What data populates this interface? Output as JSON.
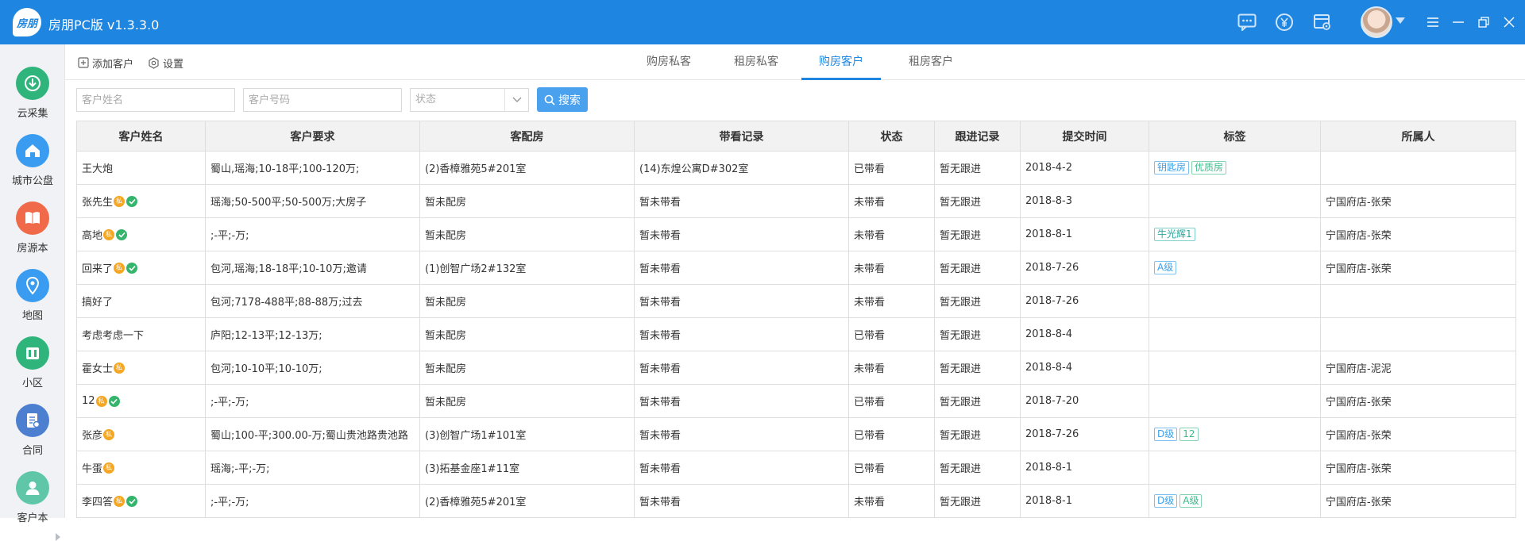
{
  "app": {
    "title": "房朋PC版 v1.3.3.0",
    "logo_text": "房朋"
  },
  "titlebar_icons": [
    "chat-icon",
    "yen-icon",
    "settings-card-icon"
  ],
  "sidebar": {
    "items": [
      {
        "label": "云采集",
        "icon": "download-cloud-icon",
        "color": "#2fb57b"
      },
      {
        "label": "城市公盘",
        "icon": "home-icon",
        "color": "#3a9cf0"
      },
      {
        "label": "房源本",
        "icon": "book-icon",
        "color": "#f06a4a"
      },
      {
        "label": "地图",
        "icon": "map-pin-icon",
        "color": "#3a9cf0"
      },
      {
        "label": "小区",
        "icon": "building-icon",
        "color": "#2fb57b"
      },
      {
        "label": "合同",
        "icon": "contract-icon",
        "color": "#4d7fd1"
      },
      {
        "label": "客户本",
        "icon": "customer-icon",
        "color": "#5fc7a8"
      }
    ]
  },
  "toolbar": {
    "add_customer": "添加客户",
    "settings": "设置",
    "tabs": [
      "购房私客",
      "租房私客",
      "购房客户",
      "租房客户"
    ],
    "active_tab": 2
  },
  "search": {
    "name_placeholder": "客户姓名",
    "phone_placeholder": "客户号码",
    "status_label": "状态",
    "button": "搜索"
  },
  "table": {
    "columns": [
      "客户姓名",
      "客户要求",
      "客配房",
      "带看记录",
      "状态",
      "跟进记录",
      "提交时间",
      "标签",
      "所属人"
    ],
    "rows": [
      {
        "name": "王大炮",
        "si": false,
        "ok": false,
        "req": "蜀山,瑶海;10-18平;100-120万;",
        "match": "(2)香樟雅苑5#201室",
        "visit": "(14)东煌公寓D#302室",
        "status": "已带看",
        "follow": "暂无跟进",
        "time": "2018-4-2",
        "tags": [
          {
            "t": "钥匙房",
            "c": "blue"
          },
          {
            "t": "优质房",
            "c": "green"
          }
        ],
        "owner": ""
      },
      {
        "name": "张先生",
        "si": true,
        "ok": true,
        "req": "瑶海;50-500平;50-500万;大房子",
        "match": "暂未配房",
        "visit": "暂未带看",
        "status": "未带看",
        "follow": "暂无跟进",
        "time": "2018-8-3",
        "tags": [],
        "owner": "宁国府店-张荣"
      },
      {
        "name": "高地",
        "si": true,
        "ok": true,
        "req": ";-平;-万;",
        "match": "暂未配房",
        "visit": "暂未带看",
        "status": "未带看",
        "follow": "暂无跟进",
        "time": "2018-8-1",
        "tags": [
          {
            "t": "牛光辉1",
            "c": "teal"
          }
        ],
        "owner": "宁国府店-张荣"
      },
      {
        "name": "回来了",
        "si": true,
        "ok": true,
        "req": "包河,瑶海;18-18平;10-10万;邀请",
        "match": "(1)创智广场2#132室",
        "visit": "暂未带看",
        "status": "未带看",
        "follow": "暂无跟进",
        "time": "2018-7-26",
        "tags": [
          {
            "t": "A级",
            "c": "blue"
          }
        ],
        "owner": "宁国府店-张荣"
      },
      {
        "name": "搞好了",
        "si": false,
        "ok": false,
        "req": "包河;7178-488平;88-88万;过去",
        "match": "暂未配房",
        "visit": "暂未带看",
        "status": "未带看",
        "follow": "暂无跟进",
        "time": "2018-7-26",
        "tags": [],
        "owner": ""
      },
      {
        "name": "考虑考虑一下",
        "si": false,
        "ok": false,
        "req": "庐阳;12-13平;12-13万;",
        "match": "暂未配房",
        "visit": "暂未带看",
        "status": "已带看",
        "follow": "暂无跟进",
        "time": "2018-8-4",
        "tags": [],
        "owner": ""
      },
      {
        "name": "霍女士",
        "si": true,
        "ok": false,
        "req": "包河;10-10平;10-10万;",
        "match": "暂未配房",
        "visit": "暂未带看",
        "status": "未带看",
        "follow": "暂无跟进",
        "time": "2018-8-4",
        "tags": [],
        "owner": "宁国府店-泥泥"
      },
      {
        "name": "12",
        "si": true,
        "ok": true,
        "req": ";-平;-万;",
        "match": "暂未配房",
        "visit": "暂未带看",
        "status": "已带看",
        "follow": "暂无跟进",
        "time": "2018-7-20",
        "tags": [],
        "owner": "宁国府店-张荣"
      },
      {
        "name": "张彦",
        "si": true,
        "ok": false,
        "req": "蜀山;100-平;300.00-万;蜀山贵池路贵池路",
        "match": "(3)创智广场1#101室",
        "visit": "暂未带看",
        "status": "已带看",
        "follow": "暂无跟进",
        "time": "2018-7-26",
        "tags": [
          {
            "t": "D级",
            "c": "blue"
          },
          {
            "t": "12",
            "c": "green"
          }
        ],
        "owner": "宁国府店-张荣"
      },
      {
        "name": "牛蛋",
        "si": true,
        "ok": false,
        "req": "瑶海;-平;-万;",
        "match": "(3)拓基金座1#11室",
        "visit": "暂未带看",
        "status": "已带看",
        "follow": "暂无跟进",
        "time": "2018-8-1",
        "tags": [],
        "owner": "宁国府店-张荣"
      },
      {
        "name": "李四答",
        "si": true,
        "ok": true,
        "req": ";-平;-万;",
        "match": "(2)香樟雅苑5#201室",
        "visit": "暂未带看",
        "status": "未带看",
        "follow": "暂无跟进",
        "time": "2018-8-1",
        "tags": [
          {
            "t": "D级",
            "c": "blue"
          },
          {
            "t": "A级",
            "c": "green"
          }
        ],
        "owner": "宁国府店-张荣"
      }
    ]
  }
}
